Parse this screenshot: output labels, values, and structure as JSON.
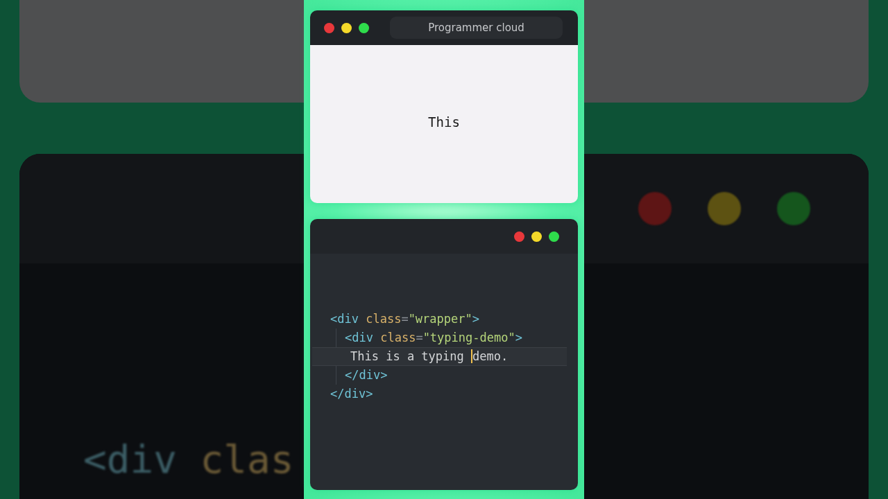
{
  "backdrop": {
    "code_fragment": [
      {
        "kind": "tag",
        "text": "<div"
      },
      {
        "kind": "attr",
        "text": " clas"
      }
    ]
  },
  "preview": {
    "title": "Programmer cloud",
    "output": "This"
  },
  "editor": {
    "lines": [
      {
        "tokens": [
          {
            "kind": "tag",
            "text": "<div"
          },
          {
            "kind": "attr",
            "text": " class"
          },
          {
            "kind": "eq",
            "text": "="
          },
          {
            "kind": "string",
            "text": "\"wrapper\""
          },
          {
            "kind": "tag",
            "text": ">"
          }
        ],
        "current": false,
        "children": [
          {
            "tokens": [
              {
                "kind": "tag",
                "text": "<div"
              },
              {
                "kind": "attr",
                "text": " class"
              },
              {
                "kind": "eq",
                "text": "="
              },
              {
                "kind": "string",
                "text": "\"typing-demo\""
              },
              {
                "kind": "tag",
                "text": ">"
              }
            ],
            "current": false,
            "children": [
              {
                "tokens": [
                  {
                    "kind": "text",
                    "text": "This is a typing "
                  },
                  {
                    "kind": "text",
                    "text": "demo.",
                    "caret_before": true
                  }
                ],
                "current": true
              }
            ]
          },
          {
            "tokens": [
              {
                "kind": "tag",
                "text": "</div>"
              }
            ],
            "current": false
          }
        ]
      },
      {
        "tokens": [
          {
            "kind": "tag",
            "text": "</div>"
          }
        ],
        "current": false
      }
    ]
  }
}
